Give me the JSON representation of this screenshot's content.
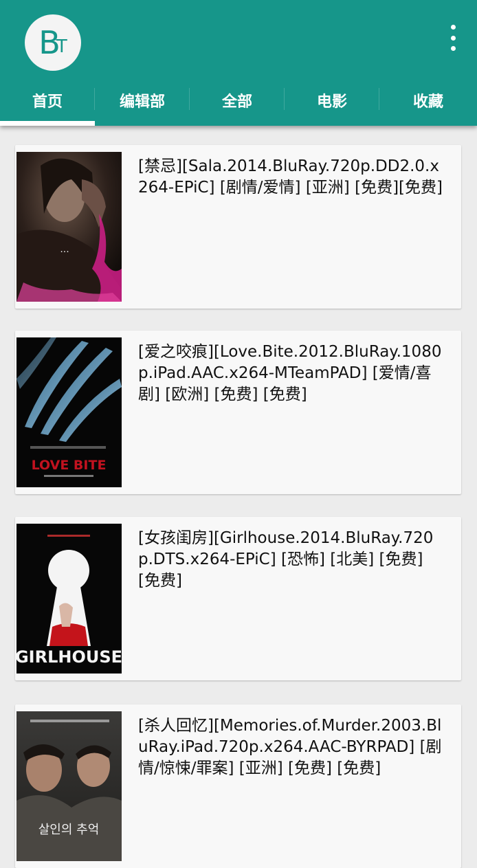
{
  "app": {
    "logo_b": "B",
    "logo_t": "T",
    "menu_icon": "more-vert-icon",
    "accent": "#16968a"
  },
  "tabs": [
    {
      "label": "首页",
      "selected": true
    },
    {
      "label": "编辑部",
      "selected": false
    },
    {
      "label": "全部",
      "selected": false
    },
    {
      "label": "电影",
      "selected": false
    },
    {
      "label": "收藏",
      "selected": false
    }
  ],
  "items": [
    {
      "title": "[禁忌][Sala.2014.BluRay.720p.DD2.0.x264-EPiC] [剧情/爱情] [亚洲] [免费][免费]"
    },
    {
      "title": "[爱之咬痕][Love.Bite.2012.BluRay.1080p.iPad.AAC.x264-MTeamPAD] [爱情/喜剧] [欧洲] [免费] [免费]",
      "poster_text": "LOVE BITE"
    },
    {
      "title": "[女孩闺房][Girlhouse.2014.BluRay.720p.DTS.x264-EPiC] [恐怖] [北美] [免费] [免费]",
      "poster_text": "GIRLHOUSE"
    },
    {
      "title": "[杀人回忆][Memories.of.Murder.2003.BluRay.iPad.720p.x264.AAC-BYRPAD] [剧情/惊悚/罪案] [亚洲] [免费] [免费]",
      "poster_text": "살인의 추억"
    }
  ]
}
